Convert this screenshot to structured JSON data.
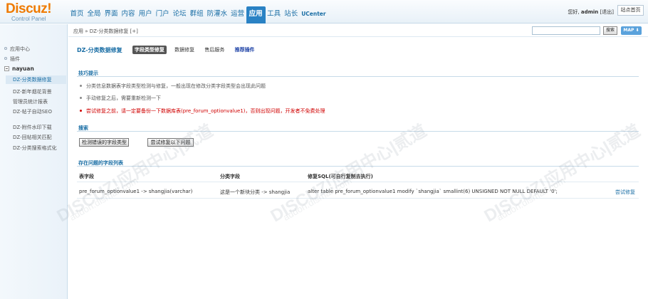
{
  "header": {
    "logo": "Discuz!",
    "logo_sub": "Control Panel",
    "nav": [
      "首页",
      "全局",
      "界面",
      "内容",
      "用户",
      "门户",
      "论坛",
      "群组",
      "防灌水",
      "运营",
      "应用",
      "工具",
      "站长",
      "UCenter"
    ],
    "active_nav": "应用",
    "greeting_prefix": "您好, ",
    "username": "admin",
    "logout": "[退出]",
    "site_home": "站点首页"
  },
  "sidebar": {
    "items": [
      "应用中心",
      "插件"
    ],
    "group": "nayuan",
    "sub_items": [
      "DZ-分类数据修复",
      "DZ-新年烟花背景",
      "管理员统计报表",
      "DZ-帖子自动SEO",
      "DZ-附件水印下载",
      "DZ-回帖相关匹配",
      "DZ-分类搜索格式化"
    ],
    "active_sub": "DZ-分类数据修复"
  },
  "breadcrumb": {
    "text": "应用 » DZ-分类数据修复 [+]",
    "search_button": "搜索",
    "map_button": "MAP ⬇"
  },
  "main": {
    "title": "DZ-分类数据修复",
    "tabs": [
      "字段类型修复",
      "数据修复",
      "售后服务",
      "推荐插件"
    ],
    "tips_title": "技巧提示",
    "tips": [
      "分类信息数据表字段类型检测与修复，一般出现在修改分类字段类型会出现此问题",
      "手动修复之后，需要重新检测一下",
      "尝试修复之前，请一定要备份一下数据库表(pre_forum_optionvalue1)，否则出现问题，开发者不免费处理"
    ],
    "search_title": "搜索",
    "search_buttons": [
      "检测错误的字段类型",
      "尝试修复以下问题"
    ],
    "list_title": "存在问题的字段列表",
    "table": {
      "headers": [
        "表字段",
        "分类字段",
        "修复SQL(可自行复制去执行)"
      ],
      "rows": [
        {
          "field": "pre_forum_optionvalue1 -> shangjia(varchar)",
          "category_field": "这是一个新块分类 -> shangjia",
          "sql": "alter table pre_forum_optionvalue1 modify `shangjia` smallint(6) UNSIGNED NOT NULL DEFAULT '0';",
          "action": "尝试修复"
        }
      ]
    }
  },
  "watermark": {
    "text": "DISCUZ!应用中心|贰道",
    "sub": "addon.dismall.com"
  },
  "colors": {
    "accent": "#1a6ea5",
    "nav_active": "#2a82c4",
    "warning": "#d00000",
    "logo": "#ef7a00"
  }
}
